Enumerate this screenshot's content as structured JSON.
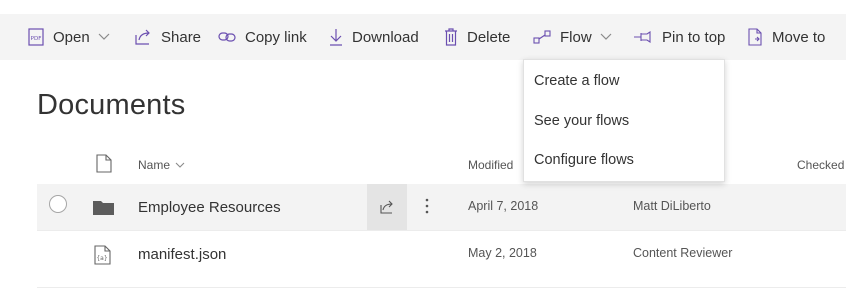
{
  "toolbar": {
    "open_label": "Open",
    "share_label": "Share",
    "copy_link_label": "Copy link",
    "download_label": "Download",
    "delete_label": "Delete",
    "flow_label": "Flow",
    "pin_label": "Pin to top",
    "move_label": "Move to"
  },
  "page": {
    "title": "Documents"
  },
  "columns": {
    "name": "Name",
    "modified": "Modified",
    "checked": "Checked"
  },
  "rows": [
    {
      "name": "Employee Resources",
      "modified": "April 7, 2018",
      "modified_by": "Matt DiLiberto",
      "type": "folder",
      "selected": true
    },
    {
      "name": "manifest.json",
      "modified": "May 2, 2018",
      "modified_by": "Content Reviewer",
      "type": "file",
      "selected": false
    }
  ],
  "flow_menu": {
    "items": [
      "Create a flow",
      "See your flows",
      "Configure flows"
    ]
  },
  "colors": {
    "accent": "#6b4fb0",
    "toolbar_bg": "#f4f4f4",
    "selected_row_bg": "#f3f3f3"
  },
  "icons": [
    "pdf-icon",
    "share-icon",
    "link-icon",
    "download-icon",
    "trash-icon",
    "flow-icon",
    "pin-icon",
    "move-icon",
    "file-icon",
    "folder-icon",
    "json-file-icon",
    "more-icon"
  ]
}
